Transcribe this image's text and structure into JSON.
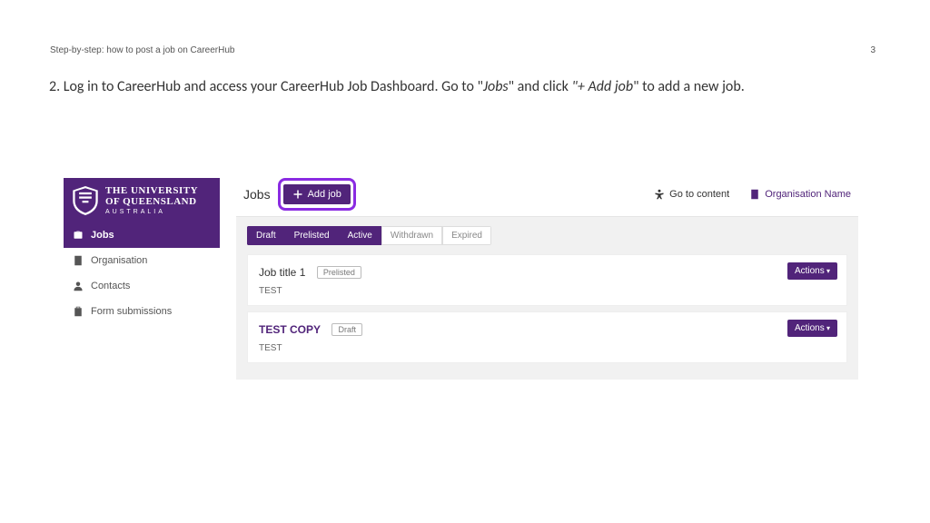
{
  "page": {
    "header": "Step-by-step: how to post a job on CareerHub",
    "number": "3",
    "instruction_prefix": "2. Log in to CareerHub and access your CareerHub Job Dashboard. Go to \"",
    "instruction_em1": "Jobs",
    "instruction_mid": "\" and click ",
    "instruction_em2": "\"+ Add job",
    "instruction_suffix": "\" to add a new job."
  },
  "logo": {
    "line1": "THE UNIVERSITY",
    "line2": "OF QUEENSLAND",
    "line3": "AUSTRALIA"
  },
  "nav": {
    "jobs": "Jobs",
    "org": "Organisation",
    "contacts": "Contacts",
    "forms": "Form submissions"
  },
  "topbar": {
    "title": "Jobs",
    "add": "Add job",
    "goto": "Go to content",
    "orgname": "Organisation Name"
  },
  "tabs": {
    "draft": "Draft",
    "prelisted": "Prelisted",
    "active": "Active",
    "withdrawn": "Withdrawn",
    "expired": "Expired"
  },
  "jobs": [
    {
      "title": "Job title 1",
      "badge": "Prelisted",
      "sub": "TEST",
      "actions": "Actions"
    },
    {
      "title": "TEST COPY",
      "badge": "Draft",
      "sub": "TEST",
      "actions": "Actions"
    }
  ]
}
